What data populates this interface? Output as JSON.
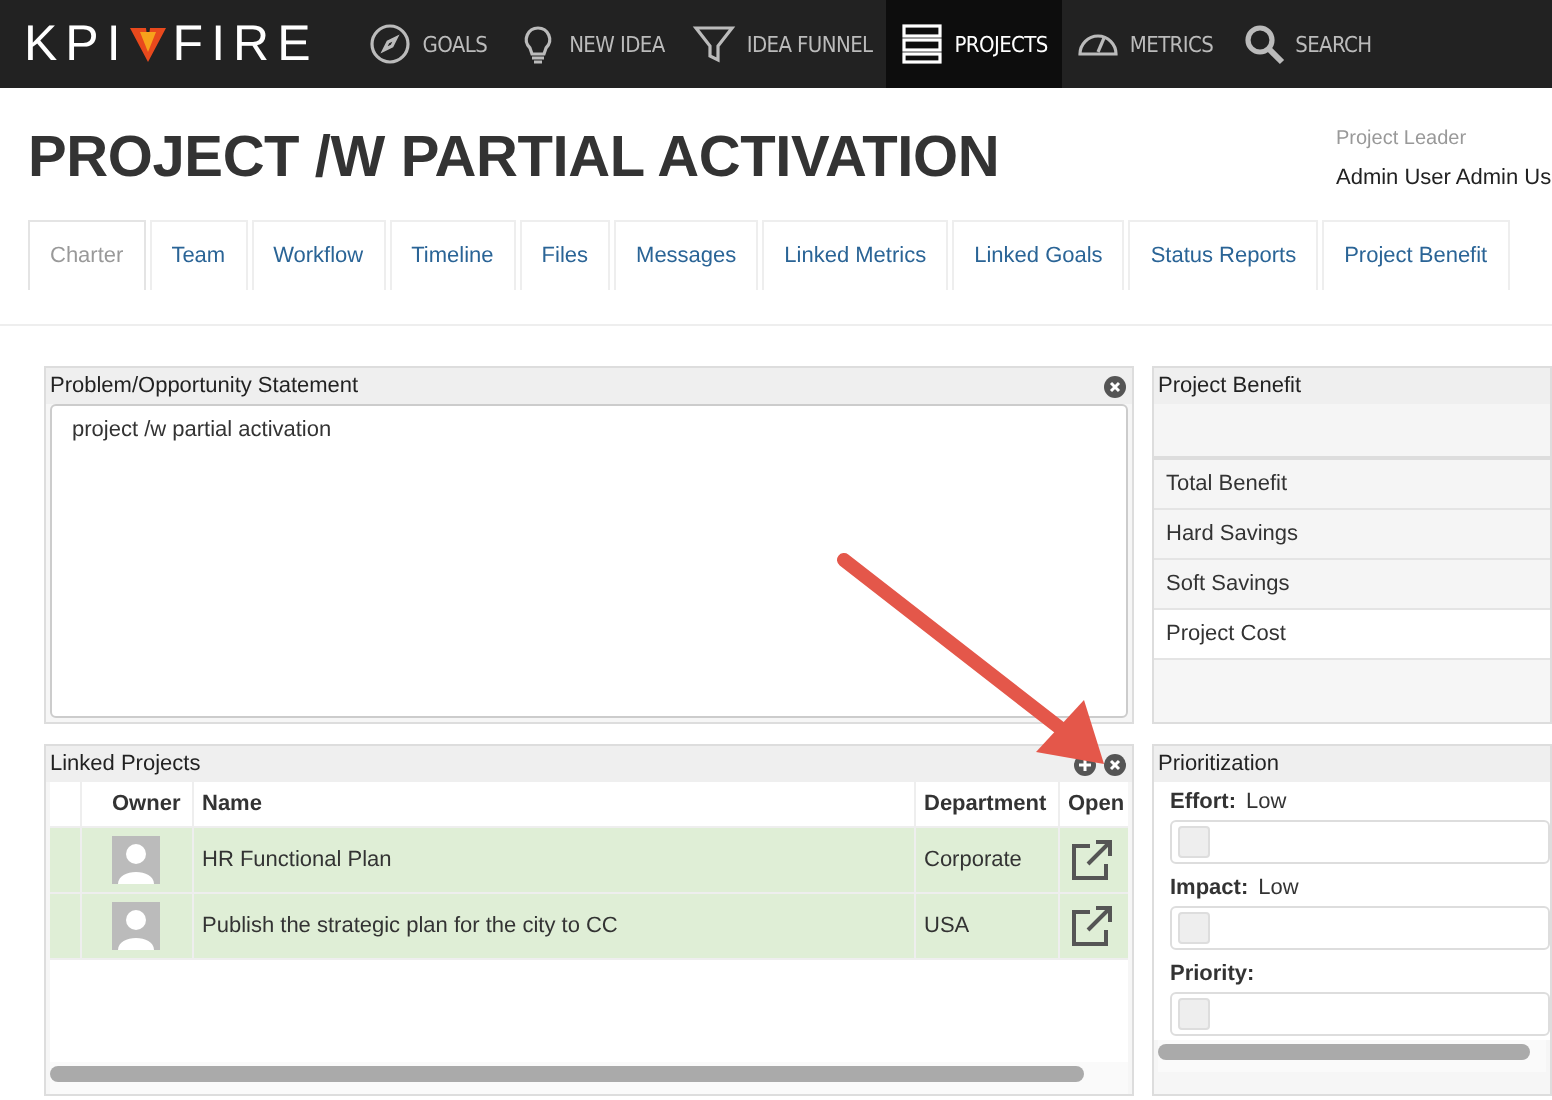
{
  "nav": {
    "logo_left": "KPI",
    "logo_right": "FIRE",
    "items": [
      {
        "kind": "compass",
        "label": "GOALS",
        "selected": false
      },
      {
        "kind": "bulb",
        "label": "NEW IDEA",
        "selected": false
      },
      {
        "kind": "funnel",
        "label": "IDEA FUNNEL",
        "selected": false
      },
      {
        "kind": "stack",
        "label": "PROJECTS",
        "selected": true
      },
      {
        "kind": "gauge",
        "label": "METRICS",
        "selected": false
      },
      {
        "kind": "search",
        "label": "SEARCH",
        "selected": false
      }
    ]
  },
  "title": "PROJECT /W PARTIAL ACTIVATION",
  "leader": {
    "label": "Project Leader",
    "value": "Admin User Admin Us"
  },
  "tabs": [
    {
      "label": "Charter",
      "selected": true
    },
    {
      "label": "Team",
      "selected": false
    },
    {
      "label": "Workflow",
      "selected": false
    },
    {
      "label": "Timeline",
      "selected": false
    },
    {
      "label": "Files",
      "selected": false
    },
    {
      "label": "Messages",
      "selected": false
    },
    {
      "label": "Linked Metrics",
      "selected": false
    },
    {
      "label": "Linked Goals",
      "selected": false
    },
    {
      "label": "Status Reports",
      "selected": false
    },
    {
      "label": "Project Benefit",
      "selected": false
    }
  ],
  "problem": {
    "title": "Problem/Opportunity Statement",
    "text": "project /w partial activation"
  },
  "benefit": {
    "title": "Project Benefit",
    "rows": [
      "Total Benefit",
      "Hard Savings",
      "Soft Savings",
      "Project Cost"
    ]
  },
  "linked_projects": {
    "title": "Linked Projects",
    "columns": [
      "Owner",
      "Name",
      "Department",
      "Open"
    ],
    "rows": [
      {
        "name": "HR Functional Plan",
        "department": "Corporate",
        "selected": true
      },
      {
        "name": "Publish the strategic plan for the city to CC",
        "department": "USA",
        "selected": true
      }
    ]
  },
  "prioritization": {
    "title": "Prioritization",
    "items": [
      {
        "label": "Effort:",
        "value": "Low"
      },
      {
        "label": "Impact:",
        "value": "Low"
      },
      {
        "label": "Priority:"
      }
    ]
  }
}
